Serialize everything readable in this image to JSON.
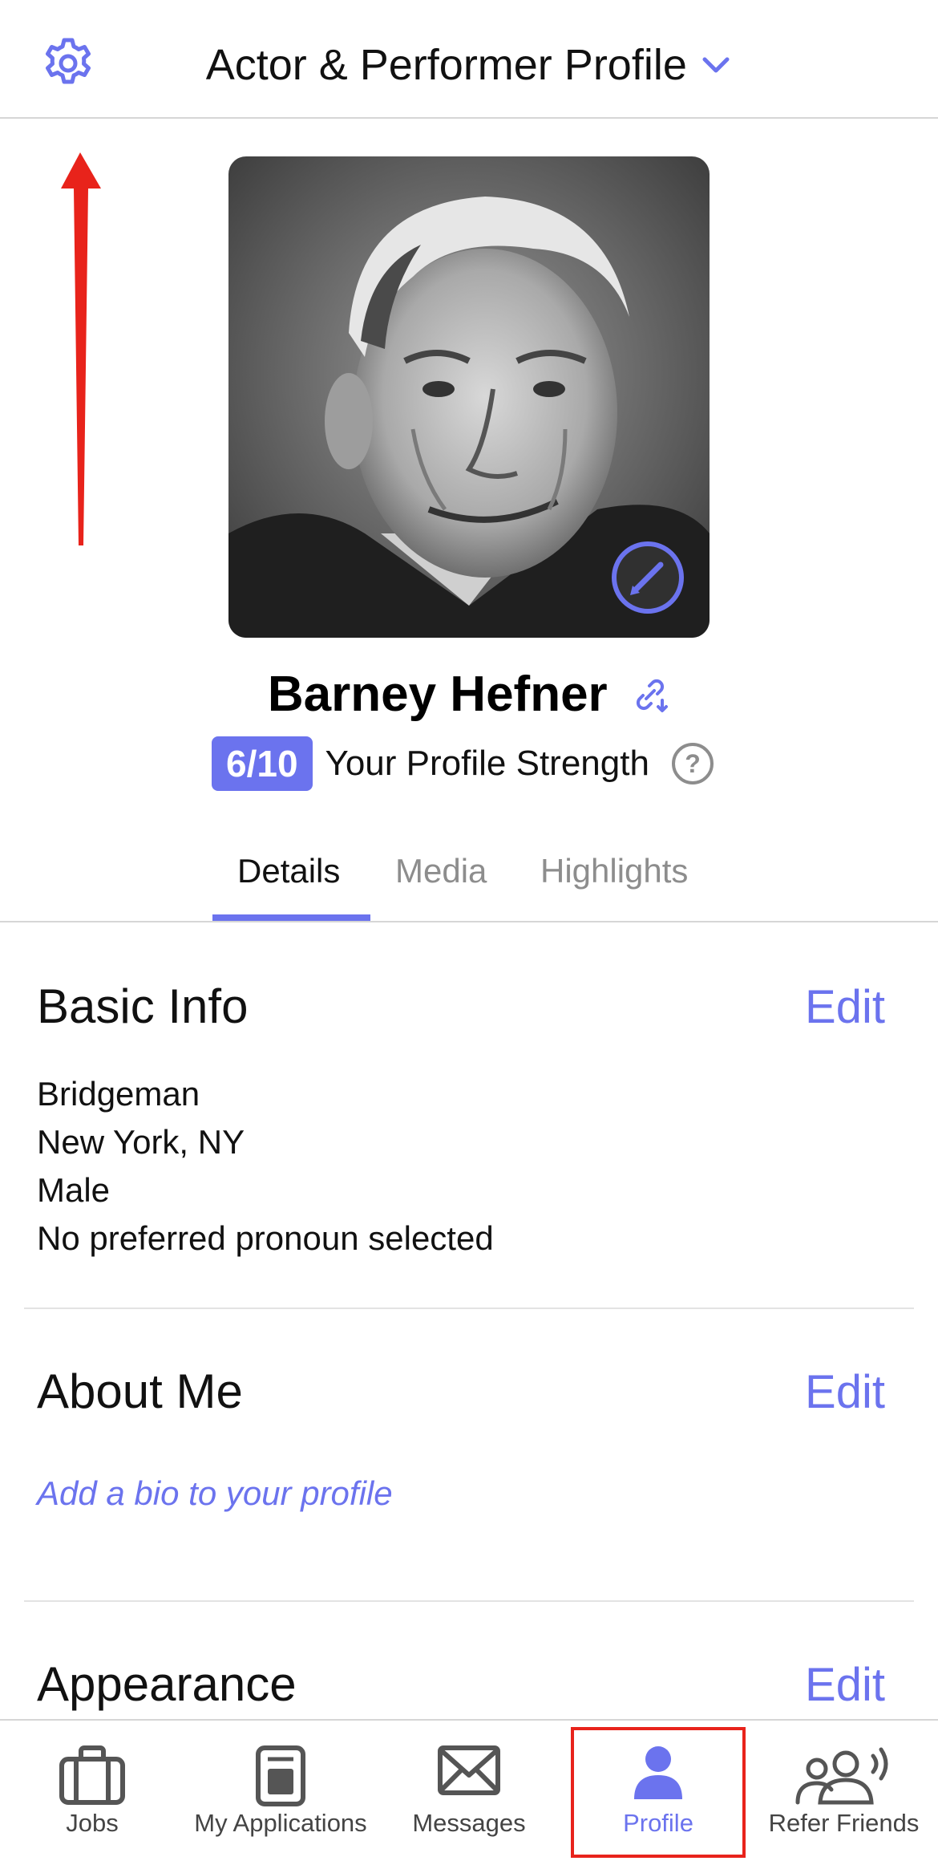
{
  "header": {
    "title": "Actor & Performer Profile",
    "settings_icon": "gear-icon",
    "dropdown_icon": "chevron-down-icon"
  },
  "profile": {
    "name": "Barney Hefner",
    "photo_alt": "profile-photo",
    "strength_score": "6/10",
    "strength_label": "Your Profile Strength"
  },
  "tabs": [
    {
      "label": "Details",
      "active": true
    },
    {
      "label": "Media",
      "active": false
    },
    {
      "label": "Highlights",
      "active": false
    }
  ],
  "sections": {
    "basic_info": {
      "title": "Basic Info",
      "edit_label": "Edit",
      "lines": [
        "Bridgeman",
        "New York, NY",
        "Male",
        "No preferred pronoun selected"
      ]
    },
    "about_me": {
      "title": "About Me",
      "edit_label": "Edit",
      "placeholder": "Add a bio to your profile"
    },
    "appearance": {
      "title": "Appearance",
      "edit_label": "Edit"
    }
  },
  "bottom_nav": [
    {
      "label": "Jobs",
      "icon": "briefcase-icon",
      "active": false
    },
    {
      "label": "My Applications",
      "icon": "applications-icon",
      "active": false
    },
    {
      "label": "Messages",
      "icon": "envelope-icon",
      "active": false
    },
    {
      "label": "Profile",
      "icon": "person-icon",
      "active": true
    },
    {
      "label": "Refer Friends",
      "icon": "refer-friends-icon",
      "active": false
    }
  ],
  "colors": {
    "accent": "#6b73ee",
    "annotation": "#e8231b",
    "divider": "#d6d6d6"
  }
}
